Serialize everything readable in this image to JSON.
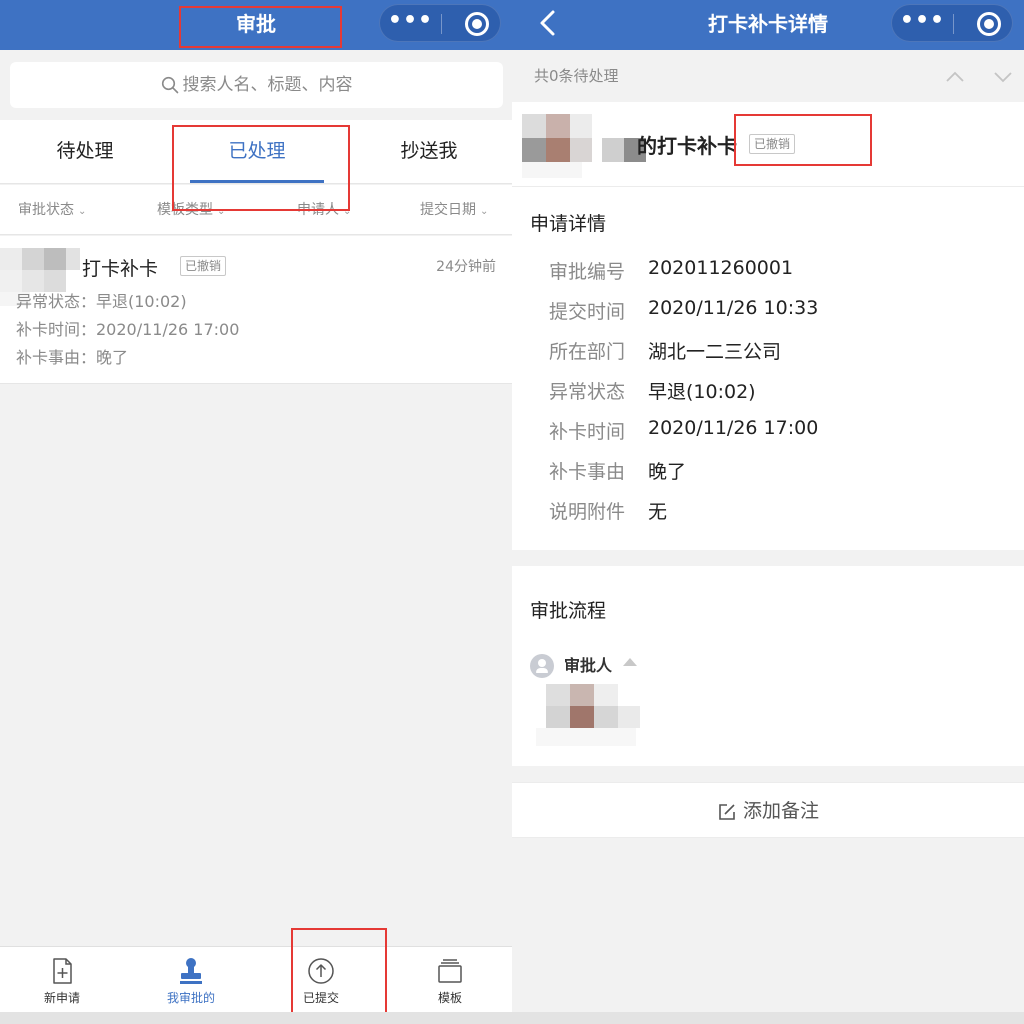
{
  "colors": {
    "nav_blue": "#3e72c3",
    "accent": "#3e72c3",
    "highlight_red": "#e53935"
  },
  "left": {
    "nav": {
      "title": "审批",
      "more_icon": "more-dots-icon",
      "close_icon": "target-icon"
    },
    "search": {
      "placeholder": "搜索人名、标题、内容",
      "icon": "search-icon"
    },
    "tabs": [
      {
        "label": "待处理",
        "active": false
      },
      {
        "label": "已处理",
        "active": true
      },
      {
        "label": "抄送我",
        "active": false
      }
    ],
    "filters": [
      "审批状态",
      "模板类型",
      "申请人",
      "提交日期"
    ],
    "record": {
      "title": "打卡补卡",
      "badge": "已撤销",
      "time_ago": "24分钟前",
      "lines": [
        "异常状态：早退(10:02)",
        "补卡时间：2020/11/26 17:00",
        "补卡事由：晚了"
      ]
    },
    "tabbar": [
      {
        "label": "新申请",
        "icon": "new-document-icon",
        "active": false
      },
      {
        "label": "我审批的",
        "icon": "stamp-icon",
        "active": true
      },
      {
        "label": "已提交",
        "icon": "upload-circle-icon",
        "active": false
      },
      {
        "label": "模板",
        "icon": "template-stack-icon",
        "active": false
      }
    ]
  },
  "right": {
    "nav": {
      "title": "打卡补卡详情",
      "back_icon": "back-arrow-icon"
    },
    "pending_count": "共0条待处理",
    "header": {
      "title": "的打卡补卡",
      "badge": "已撤销"
    },
    "details": {
      "section_title": "申请详情",
      "fields": [
        {
          "label": "审批编号",
          "value": "202011260001"
        },
        {
          "label": "提交时间",
          "value": "2020/11/26 10:33"
        },
        {
          "label": "所在部门",
          "value": "湖北一二三公司"
        },
        {
          "label": "异常状态",
          "value": "早退(10:02)"
        },
        {
          "label": "补卡时间",
          "value": "2020/11/26 17:00"
        },
        {
          "label": "补卡事由",
          "value": "晚了"
        },
        {
          "label": "说明附件",
          "value": "无"
        }
      ]
    },
    "flow": {
      "section_title": "审批流程",
      "role": "审批人"
    },
    "note": {
      "label": "添加备注",
      "icon": "edit-note-icon"
    }
  }
}
